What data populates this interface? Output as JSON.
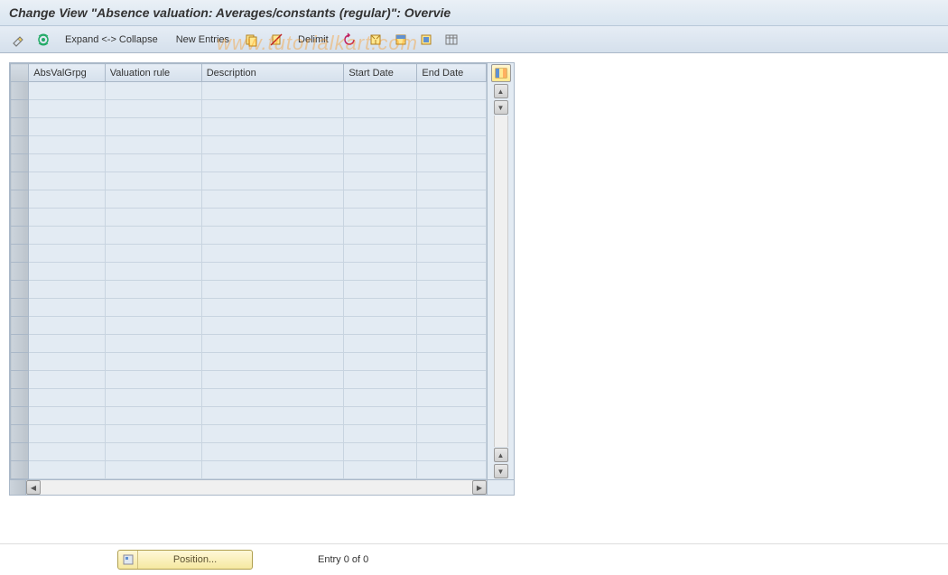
{
  "title": "Change View \"Absence valuation: Averages/constants (regular)\": Overvie",
  "toolbar": {
    "expand_collapse": "Expand <-> Collapse",
    "new_entries": "New Entries",
    "delimit": "Delimit"
  },
  "watermark": "www.tutorialkart.com",
  "table": {
    "headers": {
      "absvalgrpg": "AbsValGrpg",
      "valuation_rule": "Valuation rule",
      "description": "Description",
      "start_date": "Start Date",
      "end_date": "End Date"
    },
    "row_count": 22
  },
  "footer": {
    "position_label": "Position...",
    "entry_text": "Entry 0 of 0"
  }
}
